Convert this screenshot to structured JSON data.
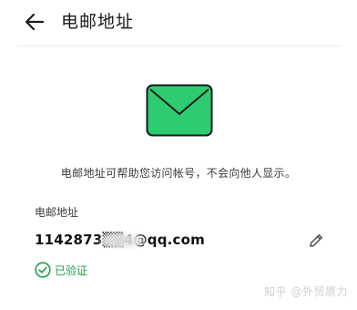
{
  "header": {
    "title": "电邮地址",
    "back_icon": "back-arrow-icon"
  },
  "hero": {
    "icon": "mail-envelope-icon",
    "color": "#2ecc71"
  },
  "description": "电邮地址可帮助您访问帐号，不会向他人显示。",
  "email": {
    "label": "电邮地址",
    "value": "1142873▒▒4@qq.com",
    "edit_icon": "pencil-edit-icon",
    "status": "已验证",
    "status_icon": "check-circle-icon",
    "status_color": "#1e9e4a"
  },
  "watermark": "知乎 @外贸原力"
}
